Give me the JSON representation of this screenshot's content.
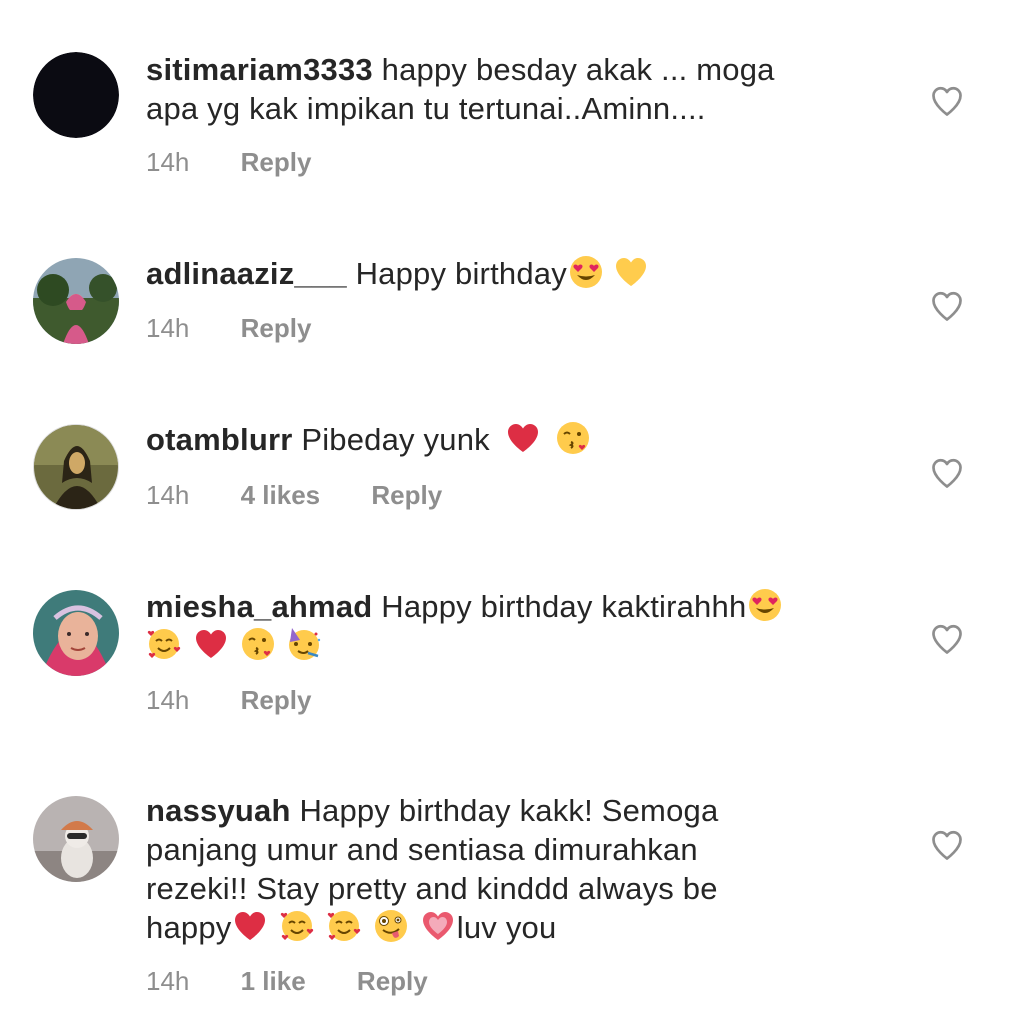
{
  "comments": [
    {
      "username": "sitimariam3333",
      "text_lines": [
        "happy besday akak ... moga",
        "apa yg kak impikan tu tertunai..Aminn...."
      ],
      "time": "14h",
      "likes": "",
      "reply": "Reply",
      "avatar_icon": "black-avatar"
    },
    {
      "username": "adlinaaziz___",
      "text": "Happy birthday",
      "emojis": [
        "heart-eyes-emoji",
        "yellow-heart-emoji"
      ],
      "time": "14h",
      "likes": "",
      "reply": "Reply",
      "avatar_icon": "photo-avatar-hijab-outdoor"
    },
    {
      "username": "otamblurr",
      "text": "Pibeday yunk",
      "emojis": [
        "red-heart-emoji",
        "kiss-emoji"
      ],
      "time": "14h",
      "likes": "4 likes",
      "reply": "Reply",
      "avatar_icon": "photo-avatar-portrait-painting"
    },
    {
      "username": "miesha_ahmad",
      "text": "Happy birthday kaktirahhh",
      "emojis_line1": [
        "heart-eyes-emoji"
      ],
      "emojis_line2": [
        "smiling-hearts-emoji",
        "red-heart-emoji",
        "kiss-emoji",
        "party-face-emoji"
      ],
      "time": "14h",
      "likes": "",
      "reply": "Reply",
      "avatar_icon": "photo-avatar-pink-hijab"
    },
    {
      "username": "nassyuah",
      "text_lines": [
        "Happy birthday kakk! Semoga",
        "panjang umur and sentiasa dimurahkan",
        "rezeki!! Stay pretty and kinddd always be"
      ],
      "text_last_prefix": "happy",
      "text_last_suffix": "luv you",
      "emojis_last": [
        "red-heart-emoji",
        "smiling-hearts-emoji",
        "smiling-hearts-emoji",
        "zany-face-emoji",
        "pink-heart-emoji"
      ],
      "time": "14h",
      "likes": "1 like",
      "reply": "Reply",
      "avatar_icon": "photo-avatar-cat-hat"
    }
  ],
  "colors": {
    "text": "#262626",
    "meta": "#8e8e8e",
    "heart_outline": "#8e8e8e"
  }
}
